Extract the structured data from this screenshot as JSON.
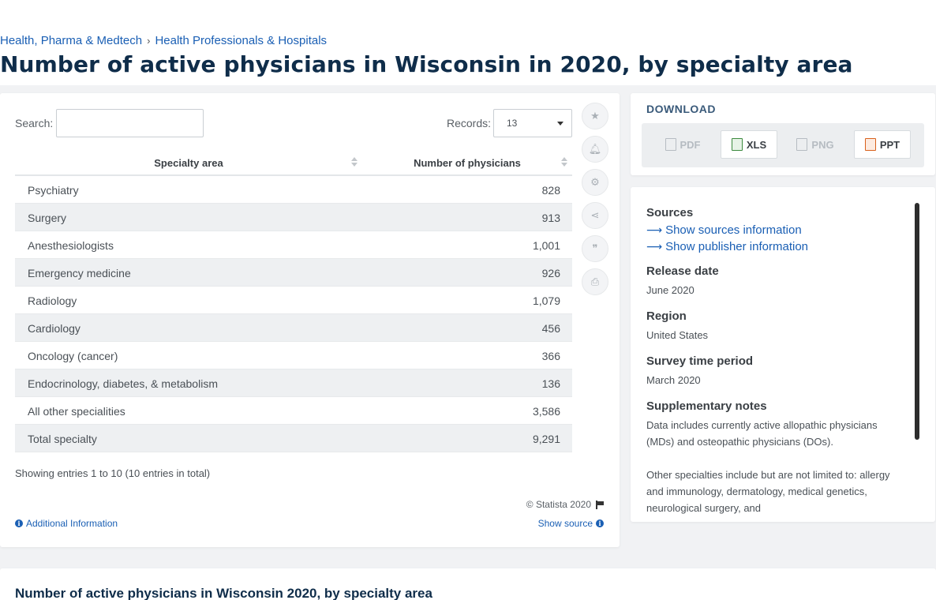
{
  "breadcrumb": {
    "items": [
      "Health, Pharma & Medtech",
      "Health Professionals & Hospitals"
    ],
    "separator": "›"
  },
  "page_title": "Number of active physicians in Wisconsin in 2020, by specialty area",
  "controls": {
    "search_label": "Search:",
    "search_value": "",
    "records_label": "Records:",
    "records_value": "13"
  },
  "table": {
    "headers": [
      "Specialty area",
      "Number of physicians"
    ],
    "rows": [
      {
        "name": "Psychiatry",
        "value": "828"
      },
      {
        "name": "Surgery",
        "value": "913"
      },
      {
        "name": "Anesthesiologists",
        "value": "1,001"
      },
      {
        "name": "Emergency medicine",
        "value": "926"
      },
      {
        "name": "Radiology",
        "value": "1,079"
      },
      {
        "name": "Cardiology",
        "value": "456"
      },
      {
        "name": "Oncology (cancer)",
        "value": "366"
      },
      {
        "name": "Endocrinology, diabetes, & metabolism",
        "value": "136"
      },
      {
        "name": "All other specialities",
        "value": "3,586"
      },
      {
        "name": "Total specialty",
        "value": "9,291"
      }
    ],
    "showing": "Showing entries 1 to 10 (10 entries in total)"
  },
  "footer": {
    "copyright": "© Statista 2020",
    "additional_info": "Additional Information",
    "show_source": "Show source"
  },
  "side_icons": [
    "star-icon",
    "bell-icon",
    "gear-icon",
    "share-icon",
    "quote-icon",
    "print-icon"
  ],
  "download": {
    "title": "DOWNLOAD",
    "buttons": [
      {
        "label": "PDF",
        "enabled": false
      },
      {
        "label": "XLS",
        "enabled": true
      },
      {
        "label": "PNG",
        "enabled": false
      },
      {
        "label": "PPT",
        "enabled": true
      }
    ]
  },
  "info": {
    "sources_title": "Sources",
    "show_sources": "Show sources information",
    "show_publisher": "Show publisher information",
    "release_date_title": "Release date",
    "release_date": "June 2020",
    "region_title": "Region",
    "region": "United States",
    "survey_title": "Survey time period",
    "survey": "March 2020",
    "notes_title": "Supplementary notes",
    "notes_1": "Data includes currently active allopathic physicians (MDs) and osteopathic physicians (DOs).",
    "notes_2": "Other specialties include but are not limited to: allergy and immunology, dermatology, medical genetics, neurological surgery, and"
  },
  "bottom": {
    "title": "Number of active physicians in Wisconsin 2020, by specialty area"
  },
  "colors": {
    "link": "#1a5fb4",
    "title": "#0f2d4a",
    "row_alt": "#eef0f2"
  }
}
